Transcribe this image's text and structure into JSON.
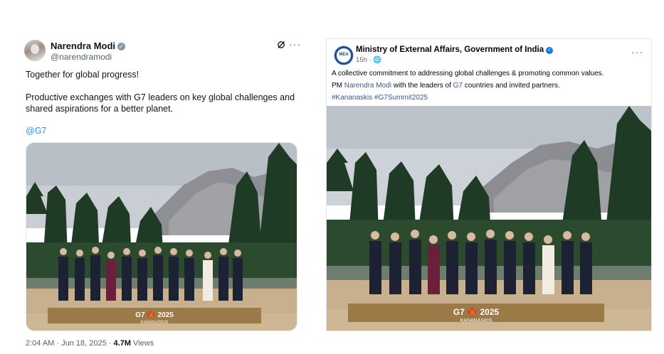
{
  "tweet": {
    "author_name": "Narendra Modi",
    "author_handle": "@narendramodi",
    "grok_icon": "grok-icon",
    "more_label": "···",
    "text_line1": "Together for global progress!",
    "text_line2": "Productive exchanges with G7 leaders on key global challenges and shared aspirations for a better planet.",
    "mention": "@G7",
    "photo_sign_main": "G7 🍁 2025",
    "photo_sign_sub": "KANANASKIS",
    "time": "2:04 AM · Jun 18, 2025 · ",
    "views_count": "4.7M",
    "views_label": " Views"
  },
  "post": {
    "page_name": "Ministry of External Affairs, Government of India",
    "logo_text": "MEA",
    "time": "15h · ",
    "globe_icon": "globe-icon",
    "more_label": "···",
    "line1": "A collective commitment to addressing global challenges & promoting common values.",
    "line2_pre": "PM ",
    "line2_link1": "Narendra Modi",
    "line2_mid": " with the leaders of ",
    "line2_link2": "G7",
    "line2_post": " countries and invited partners.",
    "hashtags": "#Kananaskis #G7Summit2025",
    "photo_sign_main": "G7 🍁 2025",
    "photo_sign_sub": "KANANASKIS"
  },
  "colors": {
    "link_blue": "#1d9bf0",
    "fb_link_blue": "#385898",
    "verified_blue": "#1877f2",
    "gov_verified_gray": "#829aab"
  }
}
